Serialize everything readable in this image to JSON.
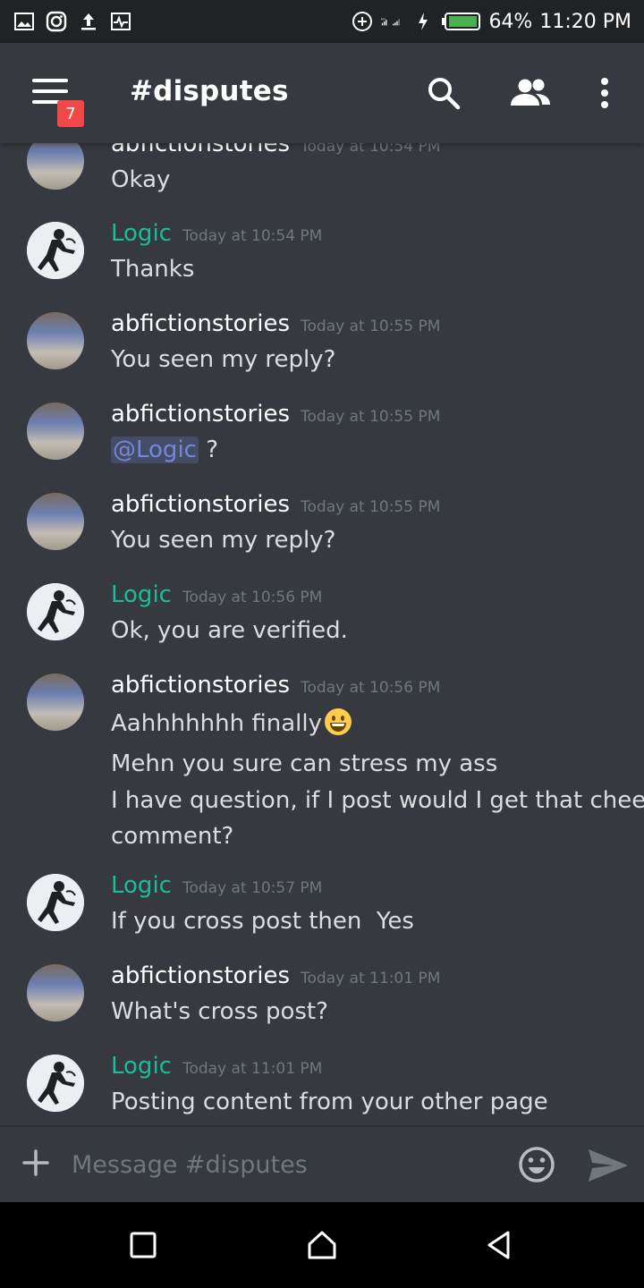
{
  "status_bar": {
    "battery": "64%",
    "time": "11:20 PM"
  },
  "header": {
    "channel": "#disputes",
    "badge_count": "7"
  },
  "colors": {
    "background": "#36393f",
    "header": "#36393f",
    "status_bar": "#202225",
    "logic_name": "#1abc9c",
    "mention": "#7289da",
    "badge": "#f04747"
  },
  "messages": [
    {
      "author": "abfictionstories",
      "time": "Today at 10:54 PM",
      "lines": [
        "Okay"
      ]
    },
    {
      "author": "Logic",
      "time": "Today at 10:54 PM",
      "lines": [
        "Thanks"
      ]
    },
    {
      "author": "abfictionstories",
      "time": "Today at 10:55 PM",
      "lines": [
        "You seen my reply?"
      ]
    },
    {
      "author": "abfictionstories",
      "time": "Today at 10:55 PM",
      "mention": "@Logic",
      "lines": [
        "?"
      ]
    },
    {
      "author": "abfictionstories",
      "time": "Today at 10:55 PM",
      "lines": [
        "You seen my reply?"
      ]
    },
    {
      "author": "Logic",
      "time": "Today at 10:56 PM",
      "lines": [
        "Ok, you are verified."
      ]
    },
    {
      "author": "abfictionstories",
      "time": "Today at 10:56 PM",
      "lines": [
        "Aahhhhhhh finally",
        "Mehn you sure can stress my ass",
        "I have question, if I post would I get that cheetah",
        "comment?"
      ]
    },
    {
      "author": "Logic",
      "time": "Today at 10:57 PM",
      "lines": [
        "If you cross post then  Yes"
      ]
    },
    {
      "author": "abfictionstories",
      "time": "Today at 11:01 PM",
      "lines": [
        "What's cross post?"
      ]
    },
    {
      "author": "Logic",
      "time": "Today at 11:01 PM",
      "lines": [
        "Posting content from your other page"
      ]
    }
  ],
  "composer": {
    "placeholder": "Message #disputes"
  },
  "icons": {
    "menu": "hamburger-icon",
    "search": "search-icon",
    "members": "members-icon",
    "more": "more-vertical-icon",
    "add": "plus-icon",
    "emoji": "emoji-icon",
    "send": "send-icon",
    "nav_recent": "square-icon",
    "nav_home": "home-icon",
    "nav_back": "back-icon"
  }
}
